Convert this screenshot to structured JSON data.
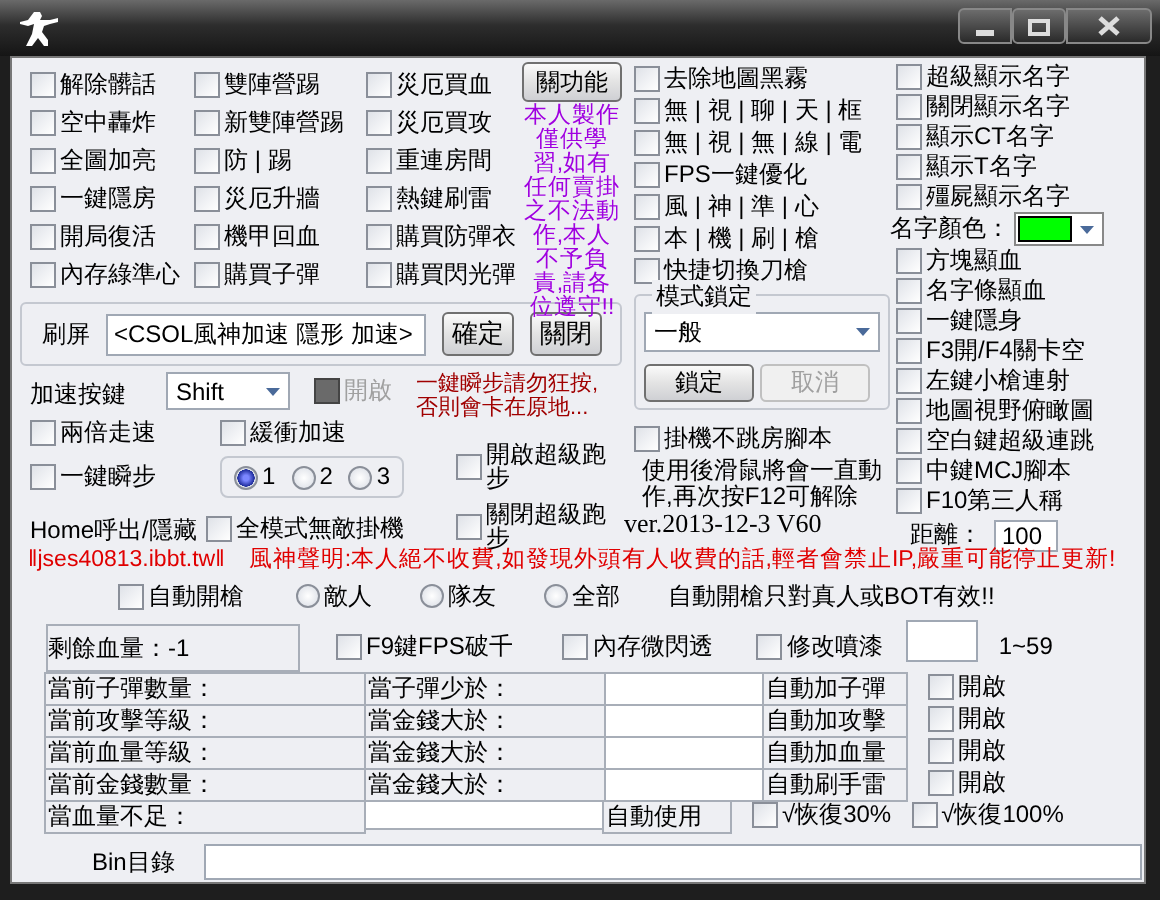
{
  "hack_toggles": [
    [
      {
        "label": "解除髒話",
        "checked": false
      },
      {
        "label": "空中轟炸",
        "checked": false
      },
      {
        "label": "全圖加亮",
        "checked": false
      },
      {
        "label": "一鍵隱房",
        "checked": false
      },
      {
        "label": "開局復活",
        "checked": false
      },
      {
        "label": "內存綠準心",
        "checked": false
      }
    ],
    [
      {
        "label": "雙陣營踢",
        "checked": false
      },
      {
        "label": "新雙陣營踢",
        "checked": false
      },
      {
        "label": "防 | 踢",
        "checked": false
      },
      {
        "label": "災厄升牆",
        "checked": false
      },
      {
        "label": "機甲回血",
        "checked": false
      },
      {
        "label": "購買子彈",
        "checked": false
      }
    ],
    [
      {
        "label": "災厄買血",
        "checked": false
      },
      {
        "label": "災厄買攻",
        "checked": false
      },
      {
        "label": "重連房間",
        "checked": false
      },
      {
        "label": "熱鍵刷雷",
        "checked": false
      },
      {
        "label": "購買防彈衣",
        "checked": false
      },
      {
        "label": "購買閃光彈",
        "checked": false
      }
    ]
  ],
  "function_button": "關功能",
  "disclaimer": "本人製作僅供學習,如有任何賣掛之不法動作,本人不予負責,請各位遵守!!",
  "display_toggles": [
    {
      "label": "去除地圖黑霧",
      "checked": false
    },
    {
      "label": "無 | 視 | 聊 | 天 | 框",
      "checked": false
    },
    {
      "label": "無 | 視 | 無 | 線 | 電",
      "checked": false
    },
    {
      "label": "FPS一鍵優化",
      "checked": false
    },
    {
      "label": "風 | 神 | 準 | 心",
      "checked": false
    },
    {
      "label": "本 | 機 | 刷 | 槍",
      "checked": false
    },
    {
      "label": "快捷切換刀槍",
      "checked": false
    }
  ],
  "mode_lock": {
    "title": "模式鎖定",
    "mode": "一般",
    "lock_button": "鎖定",
    "cancel_button": {
      "label": "取消",
      "disabled": true
    }
  },
  "name_toggles": [
    {
      "label": "超級顯示名字",
      "checked": false
    },
    {
      "label": "關閉顯示名字",
      "checked": false
    },
    {
      "label": "顯示CT名字",
      "checked": false
    },
    {
      "label": "顯示T名字",
      "checked": false
    },
    {
      "label": "殭屍顯示名字",
      "checked": false
    }
  ],
  "name_color": {
    "label": "名字顏色：",
    "color": "#00ff00"
  },
  "extra_toggles": [
    {
      "label": "方塊顯血",
      "checked": false
    },
    {
      "label": "名字條顯血",
      "checked": false
    },
    {
      "label": "一鍵隱身",
      "checked": false
    },
    {
      "label": "F3開/F4關卡空",
      "checked": false
    },
    {
      "label": "左鍵小槍連射",
      "checked": false
    },
    {
      "label": "地圖視野俯瞰圖",
      "checked": false
    },
    {
      "label": "空白鍵超級連跳",
      "checked": false
    },
    {
      "label": "中鍵MCJ腳本",
      "checked": false
    },
    {
      "label": "F10第三人稱",
      "checked": false
    }
  ],
  "distance": {
    "label": "距離：",
    "value": "100"
  },
  "spam": {
    "label": "刷屏",
    "value": "<CSOL風神加速 隱形 加速>",
    "confirm_button": "確定",
    "close_button": "關閉"
  },
  "speed_key": {
    "label": "加速按鍵",
    "key": "Shift",
    "enable": {
      "label": "開啟",
      "checked": false,
      "disabled": true
    }
  },
  "warning": "一鍵瞬步請勿狂按,否則會卡在原地...",
  "double_speed": {
    "label": "兩倍走速",
    "checked": false
  },
  "buffer_speed": {
    "label": "緩衝加速",
    "checked": false
  },
  "blink": {
    "label": "一鍵瞬步",
    "checked": false
  },
  "blink_steps": [
    {
      "label": "1",
      "selected": true
    },
    {
      "label": "2",
      "selected": false
    },
    {
      "label": "3",
      "selected": false
    }
  ],
  "run_toggles": [
    {
      "label": "開啟超級跑步",
      "checked": false
    },
    {
      "label": "關閉超級跑步",
      "checked": false
    }
  ],
  "hotkey_note": "Home呼出/隱藏",
  "invincible": {
    "label": "全模式無敵掛機",
    "checked": false
  },
  "afk_script": {
    "label": "掛機不跳房腳本",
    "checked": false
  },
  "afk_note": "使用後滑鼠將會一直動作,再次按F12可解除",
  "version": "ver.2013-12-3 V60",
  "site": "‖jses40813.ibbt.tw‖",
  "statement": "風神聲明:本人絕不收費,如發現外頭有人收費的話,輕者會禁止IP,嚴重可能停止更新!",
  "auto_fire": {
    "label": "自動開槍",
    "checked": false,
    "targets": [
      {
        "label": "敵人",
        "selected": false
      },
      {
        "label": "隊友",
        "selected": false
      },
      {
        "label": "全部",
        "selected": false
      }
    ],
    "note": "自動開槍只對真人或BOT有效!!"
  },
  "health_left": "剩餘血量：-1",
  "misc_toggles": [
    {
      "label": "F9鍵FPS破千",
      "checked": false
    },
    {
      "label": "內存微閃透",
      "checked": false
    },
    {
      "label": "修改噴漆",
      "checked": false
    }
  ],
  "spray_range": "1~59",
  "auto_rows": [
    {
      "status": "當前子彈數量：",
      "condition": "當子彈少於：",
      "action": "自動加子彈",
      "enable": {
        "label": "開啟",
        "checked": false
      }
    },
    {
      "status": "當前攻擊等級：",
      "condition": "當金錢大於：",
      "action": "自動加攻擊",
      "enable": {
        "label": "開啟",
        "checked": false
      }
    },
    {
      "status": "當前血量等級：",
      "condition": "當金錢大於：",
      "action": "自動加血量",
      "enable": {
        "label": "開啟",
        "checked": false
      }
    },
    {
      "status": "當前金錢數量：",
      "condition": "當金錢大於：",
      "action": "自動刷手雷",
      "enable": {
        "label": "開啟",
        "checked": false
      }
    }
  ],
  "low_health": {
    "label": "當血量不足：",
    "action": "自動使用",
    "options": [
      {
        "label": "√恢復30%",
        "checked": false
      },
      {
        "label": "√恢復100%",
        "checked": false
      }
    ]
  },
  "bin_dir": {
    "label": "Bin目錄"
  }
}
